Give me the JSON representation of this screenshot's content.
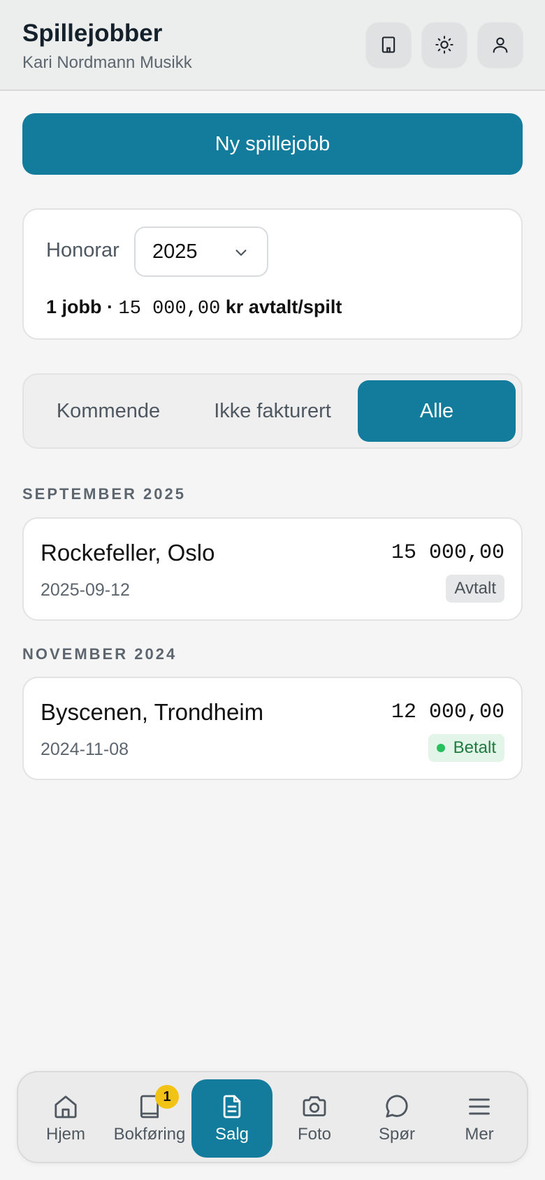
{
  "header": {
    "title": "Spillejobber",
    "subtitle": "Kari Nordmann Musikk",
    "icons": [
      "building-icon",
      "sun-icon",
      "user-icon"
    ]
  },
  "actions": {
    "new_gig": "Ny spillejobb"
  },
  "summary": {
    "label": "Honorar",
    "year": "2025",
    "count_text": "1 jobb · ",
    "amount": "15 000,00",
    "suffix": " kr avtalt/spilt"
  },
  "tabs": [
    {
      "label": "Kommende",
      "active": false
    },
    {
      "label": "Ikke fakturert",
      "active": false
    },
    {
      "label": "Alle",
      "active": true
    }
  ],
  "groups": [
    {
      "heading": "SEPTEMBER 2025",
      "jobs": [
        {
          "name": "Rockefeller, Oslo",
          "amount": "15 000,00",
          "date": "2025-09-12",
          "status": "Avtalt"
        }
      ]
    },
    {
      "heading": "NOVEMBER 2024",
      "jobs": [
        {
          "name": "Byscenen, Trondheim",
          "amount": "12 000,00",
          "date": "2024-11-08",
          "status": "Betalt"
        }
      ]
    }
  ],
  "nav": {
    "items": [
      {
        "label": "Hjem",
        "icon": "home-icon"
      },
      {
        "label": "Bokføring",
        "icon": "book-icon",
        "badge": "1"
      },
      {
        "label": "Salg",
        "icon": "document-icon",
        "active": true
      },
      {
        "label": "Foto",
        "icon": "camera-icon"
      },
      {
        "label": "Spør",
        "icon": "chat-icon"
      },
      {
        "label": "Mer",
        "icon": "menu-icon"
      }
    ]
  },
  "colors": {
    "accent": "#137b9b",
    "badge": "#f2c315",
    "paid": "#26c05e"
  }
}
